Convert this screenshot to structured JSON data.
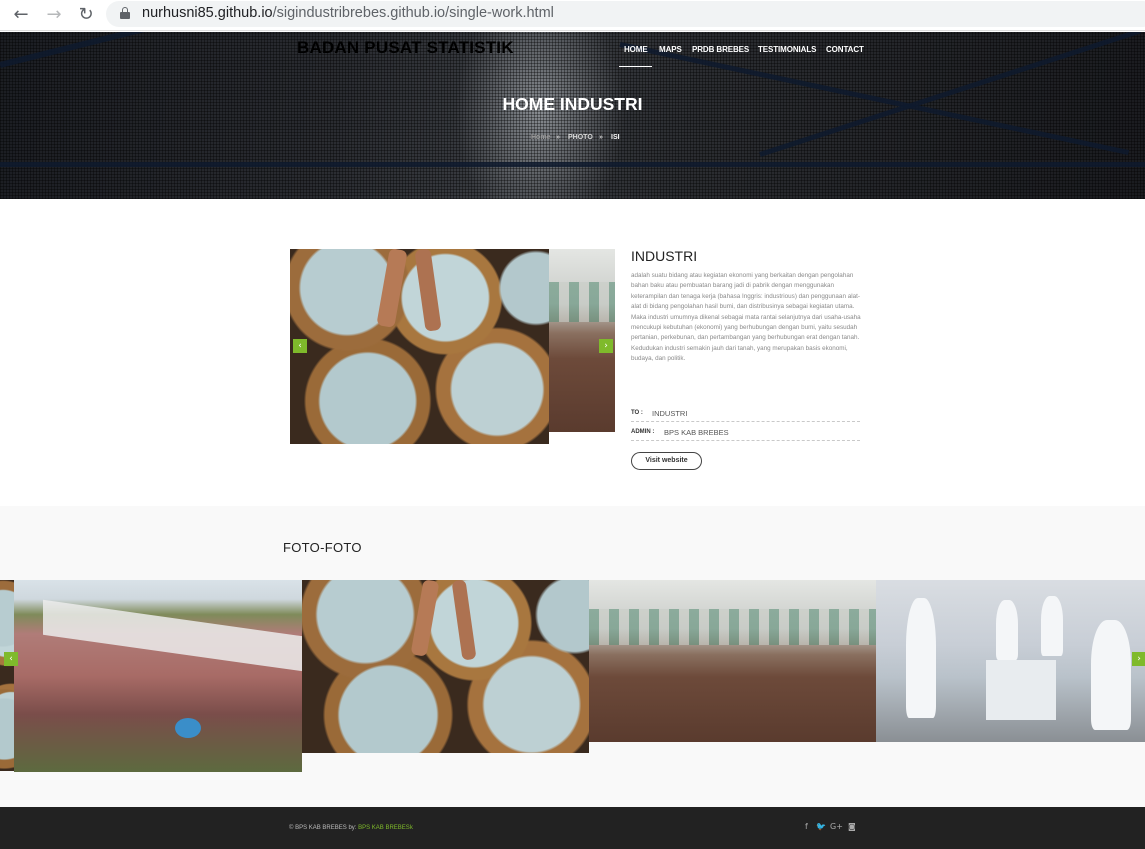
{
  "browser": {
    "url_domain": "nurhusni85.github.io",
    "url_path": "/sigindustribrebes.github.io/single-work.html"
  },
  "header": {
    "brand": "BADAN PUSAT STATISTIK",
    "menu": [
      "HOME",
      "MAPS",
      "PRDB BREBES",
      "TESTIMONIALS",
      "CONTACT"
    ],
    "active_menu": "HOME",
    "title": "HOME INDUSTRI",
    "breadcrumb": [
      "Home",
      "PHOTO",
      "ISI"
    ]
  },
  "detail": {
    "title": "INDUSTRI",
    "description": "adalah suatu bidang atau kegiatan ekonomi yang berkaitan dengan pengolahan bahan baku atau pembuatan barang jadi di pabrik dengan menggunakan keterampilan dan tenaga kerja (bahasa Inggris: industrious) dan penggunaan alat-alat di bidang pengolahan hasil bumi, dan distribusinya sebagai kegiatan utama. Maka industri umumnya dikenal sebagai mata rantai selanjutnya dari usaha-usaha mencukupi kebutuhan (ekonomi) yang berhubungan dengan bumi, yaitu sesudah pertanian, perkebunan, dan pertambangan yang berhubungan erat dengan tanah. Kedudukan industri semakin jauh dari tanah, yang merupakan basis ekonomi, budaya, dan politik.",
    "to_label": "TO :",
    "to_value": "INDUSTRI",
    "admin_label": "ADMIN :",
    "admin_value": "BPS KAB BREBES",
    "visit_label": "Visit website"
  },
  "gallery": {
    "title": "FOTO-FOTO"
  },
  "footer": {
    "copyright": "© BPS KAB BREBES by:",
    "credit": "BPS KAB BREBESk",
    "social_icons": [
      "facebook-icon",
      "twitter-icon",
      "google-plus-icon",
      "instagram-icon"
    ]
  },
  "colors": {
    "accent": "#7fba2b",
    "footer_bg": "#222222",
    "gallery_bg": "#f9f9f9"
  }
}
